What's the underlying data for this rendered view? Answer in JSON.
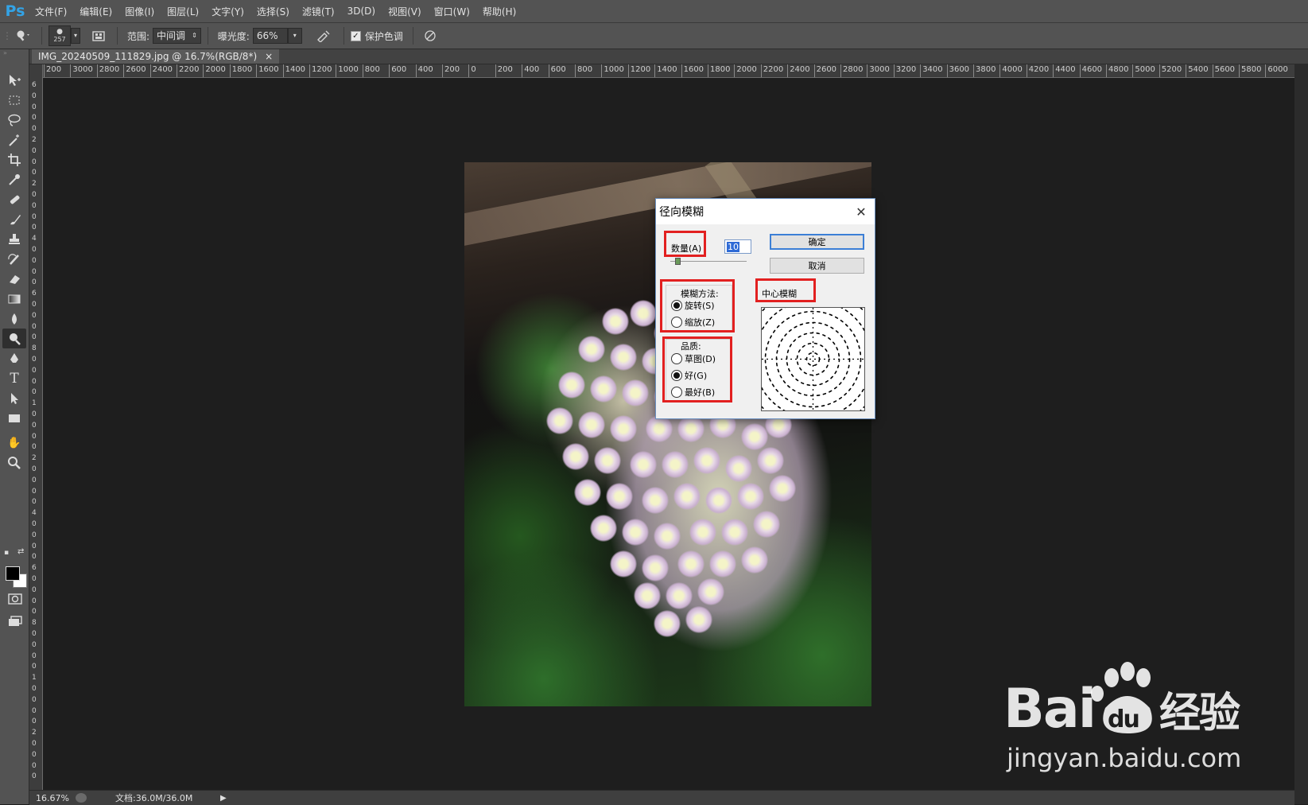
{
  "app": {
    "logo": "Ps",
    "menu": [
      "文件(F)",
      "编辑(E)",
      "图像(I)",
      "图层(L)",
      "文字(Y)",
      "选择(S)",
      "滤镜(T)",
      "3D(D)",
      "视图(V)",
      "窗口(W)",
      "帮助(H)"
    ]
  },
  "options": {
    "brush_size": "257",
    "range_label": "范围:",
    "range_value": "中间调",
    "exposure_label": "曝光度:",
    "exposure_value": "66%",
    "protect_tones_label": "保护色调",
    "protect_tones_checked": true
  },
  "document": {
    "tab_title": "IMG_20240509_111829.jpg @ 16.7%(RGB/8*)",
    "close": "×"
  },
  "ruler_top_ticks": [
    "200",
    "3000",
    "2800",
    "2600",
    "2400",
    "2200",
    "2000",
    "1800",
    "1600",
    "1400",
    "1200",
    "1000",
    "800",
    "600",
    "400",
    "200",
    "0",
    "200",
    "400",
    "600",
    "800",
    "1000",
    "1200",
    "1400",
    "1600",
    "1800",
    "2000",
    "2200",
    "2400",
    "2600",
    "2800",
    "3000",
    "3200",
    "3400",
    "3600",
    "3800",
    "4000",
    "4200",
    "4400",
    "4600",
    "4800",
    "5000",
    "5200",
    "5400",
    "5600",
    "5800",
    "6000"
  ],
  "status": {
    "zoom": "16.67%",
    "doc_size": "文档:36.0M/36.0M"
  },
  "dialog": {
    "title": "径向模糊",
    "amount_label": "数量(A)",
    "amount_value": "10",
    "ok_label": "确定",
    "cancel_label": "取消",
    "method_label": "模糊方法:",
    "method_spin": "旋转(S)",
    "method_zoom": "缩放(Z)",
    "method_selected": "spin",
    "quality_label": "品质:",
    "quality_draft": "草图(D)",
    "quality_good": "好(G)",
    "quality_best": "最好(B)",
    "quality_selected": "good",
    "center_label": "中心模糊"
  },
  "watermark": {
    "logo": "Bai du 经验",
    "url": "jingyan.baidu.com"
  },
  "colors": {
    "ps_blue": "#33a3e6",
    "highlight_red": "#e22020",
    "panel_gray": "#535353"
  }
}
